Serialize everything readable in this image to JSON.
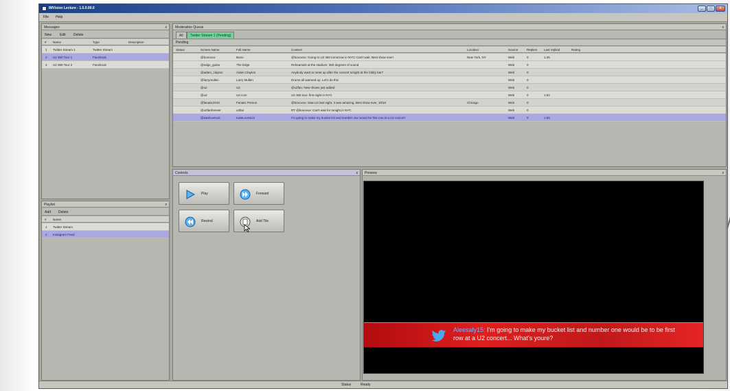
{
  "window": {
    "title": "IMVision Lecture - 1.5.0.00.0",
    "controls": [
      "_",
      "□",
      "X"
    ]
  },
  "menubar": {
    "items": [
      "File",
      "Help"
    ]
  },
  "left_top_panel": {
    "title": "Messages",
    "toolbar": [
      "New",
      "Edit",
      "Delete"
    ],
    "columns": [
      "#",
      "Name",
      "Type",
      "Description"
    ],
    "rows": [
      {
        "num": "1",
        "name": "Twitter Stream 1",
        "type": "Twitter Stream",
        "description": ""
      },
      {
        "num": "2",
        "name": "U2 360 Tour 1",
        "type": "Facebook",
        "description": ""
      },
      {
        "num": "3",
        "name": "U2 360 Tour 2",
        "type": "Facebook",
        "description": ""
      }
    ]
  },
  "left_bottom_panel": {
    "title": "Playlist",
    "toolbar": [
      "Add",
      "Delete"
    ],
    "columns": [
      "#",
      "Name"
    ],
    "rows": [
      {
        "num": "1",
        "name": "Twitter Stream"
      },
      {
        "num": "2",
        "name": "Instagram Feed"
      }
    ]
  },
  "main_panel": {
    "title": "Moderation Queue",
    "tabs": [
      {
        "label": "All",
        "active": false
      },
      {
        "label": "Twitter Stream 1 (Pending)",
        "active": true
      }
    ],
    "section_label": "Pending",
    "columns": [
      "Status",
      "Screen Name",
      "Full Name",
      "Content",
      "Location",
      "Source",
      "Replies",
      "Last replied",
      "Rating"
    ],
    "rows": [
      {
        "status": "",
        "screen_name": "@bonovox",
        "full_name": "Bono",
        "content": "@bonovox: Going to U2 360 tomorrow in NYC! Can't wait. Best show ever!",
        "location": "New York, NY",
        "source": "Web",
        "replies": "0",
        "last_replied": "1:45",
        "rating": ""
      },
      {
        "status": "",
        "screen_name": "@edge_guitar",
        "full_name": "The Edge",
        "content": "Rehearsals at the stadium: 360 degrees of sound",
        "location": "",
        "source": "Web",
        "replies": "0",
        "last_replied": "",
        "rating": ""
      },
      {
        "status": "",
        "screen_name": "@adam_clayton",
        "full_name": "Adam Clayton",
        "content": "Anybody want to meet up after the concert tonight at the lobby bar?",
        "location": "",
        "source": "Web",
        "replies": "0",
        "last_replied": "",
        "rating": "",
        "alt": true
      },
      {
        "status": "",
        "screen_name": "@larrymullen",
        "full_name": "Larry Mullen",
        "content": "Drums all warmed up. Let's do this",
        "location": "",
        "source": "Web",
        "replies": "0",
        "last_replied": "",
        "rating": ""
      },
      {
        "status": "",
        "screen_name": "@u2",
        "full_name": "U2",
        "content": "@u2fan: New shows just added",
        "location": "",
        "source": "Web",
        "replies": "0",
        "last_replied": "",
        "rating": "",
        "alt": true
      },
      {
        "status": "",
        "screen_name": "@u2",
        "full_name": "U2.com",
        "content": "U2 360 tour: first night in NYC",
        "location": "",
        "source": "Web",
        "replies": "0",
        "last_replied": "1:52",
        "rating": ""
      },
      {
        "status": "",
        "screen_name": "@fanatic2010",
        "full_name": "Fanatic Person",
        "content": "@bonovox: Saw U2 last night, it was amazing. Best show ever, 10/10",
        "location": "Chicago",
        "source": "Web",
        "replies": "0",
        "last_replied": "",
        "rating": "",
        "alt": true
      },
      {
        "status": "",
        "screen_name": "@u2fanforever",
        "full_name": "u2fan",
        "content": "RT @bonovox: Can't wait for tonight in NYC",
        "location": "",
        "source": "Web",
        "replies": "0",
        "last_replied": "",
        "rating": ""
      },
      {
        "status": "",
        "screen_name": "@katelovesu2",
        "full_name": "KateLovesU2",
        "content": "I'm going to make my bucket list and number one would be first row at a U2 concert",
        "location": "",
        "source": "Web",
        "replies": "0",
        "last_replied": "1:55",
        "rating": "",
        "selected": true
      }
    ]
  },
  "controls_panel": {
    "title": "Controls",
    "buttons": [
      {
        "id": "play",
        "label": "Play",
        "sub": ""
      },
      {
        "id": "forward",
        "label": "Forward",
        "sub": ""
      },
      {
        "id": "rewind",
        "label": "Rewind",
        "sub": ""
      },
      {
        "id": "add",
        "label": "Add Tile",
        "sub": ""
      }
    ]
  },
  "preview_panel": {
    "title": "Preview",
    "ticker": {
      "handle": "Aleesaly15:",
      "message": " I'm going to make my bucket list and number one would be to be first row at a U2 concert... What's youre?"
    }
  },
  "statusbar": {
    "label": "Status",
    "value": "Ready"
  },
  "colors": {
    "title_start": "#1b3f84",
    "title_end": "#a9bde3",
    "tab_active": "#6fd39a",
    "row_selected": "#a9a9df",
    "ticker_red": "#e01e1e",
    "twitter_bird": "#4aa9ee"
  },
  "icons": {
    "play": "play-triangle-icon",
    "forward": "fast-forward-icon",
    "rewind": "rewind-icon",
    "add": "add-tile-icon",
    "bird": "twitter-bird-icon"
  }
}
